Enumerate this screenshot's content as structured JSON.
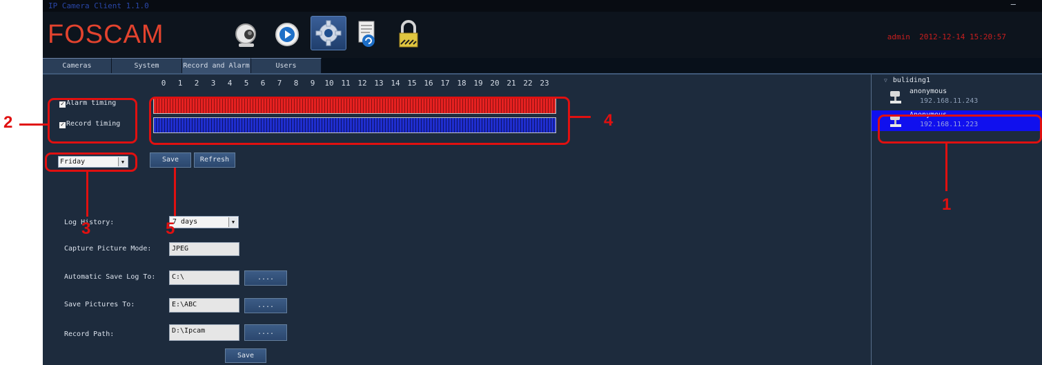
{
  "window": {
    "title": "IP Camera Client 1.1.0",
    "minimize": "–"
  },
  "header": {
    "logo": "FOSCAM",
    "toolbar_icons": [
      "camera-icon",
      "playback-icon",
      "settings-gear-icon",
      "document-icon",
      "lock-icon"
    ],
    "active_icon": "settings-gear-icon",
    "user": "admin",
    "datetime": "2012-12-14 15:20:57"
  },
  "tabs": [
    {
      "label": "Cameras"
    },
    {
      "label": "System"
    },
    {
      "label": "Record and Alarm"
    },
    {
      "label": "Users"
    }
  ],
  "active_tab": "Record and Alarm",
  "schedule": {
    "hours": [
      "0",
      "1",
      "2",
      "3",
      "4",
      "5",
      "6",
      "7",
      "8",
      "9",
      "10",
      "11",
      "12",
      "13",
      "14",
      "15",
      "16",
      "17",
      "18",
      "19",
      "20",
      "21",
      "22",
      "23"
    ],
    "alarm_timing_label": "Alarm timing",
    "alarm_timing_checked": true,
    "record_timing_label": "Record timing",
    "record_timing_checked": true,
    "alarm_color": "#e62121",
    "record_color": "#1f2ed0",
    "day_selected": "Friday",
    "save_label": "Save",
    "refresh_label": "Refresh"
  },
  "settings": {
    "log_history_label": "Log History:",
    "log_history_value": "7 days",
    "capture_mode_label": "Capture Picture Mode:",
    "capture_mode_value": "JPEG",
    "auto_save_log_label": "Automatic Save Log To:",
    "auto_save_log_value": "C:\\",
    "save_pictures_label": "Save Pictures To:",
    "save_pictures_value": "E:\\ABC",
    "record_path_label": "Record Path:",
    "record_path_value": "D:\\Ipcam",
    "browse_label": "....",
    "save_label": "Save"
  },
  "sidebar": {
    "group": "buliding1",
    "devices": [
      {
        "name": "anonymous",
        "ip": "192.168.11.243",
        "selected": false
      },
      {
        "name": "Anonymous",
        "ip": "192.168.11.223",
        "selected": true
      }
    ]
  },
  "annotations": {
    "color": "#e01010",
    "labels": [
      "1",
      "2",
      "3",
      "4",
      "5"
    ]
  }
}
